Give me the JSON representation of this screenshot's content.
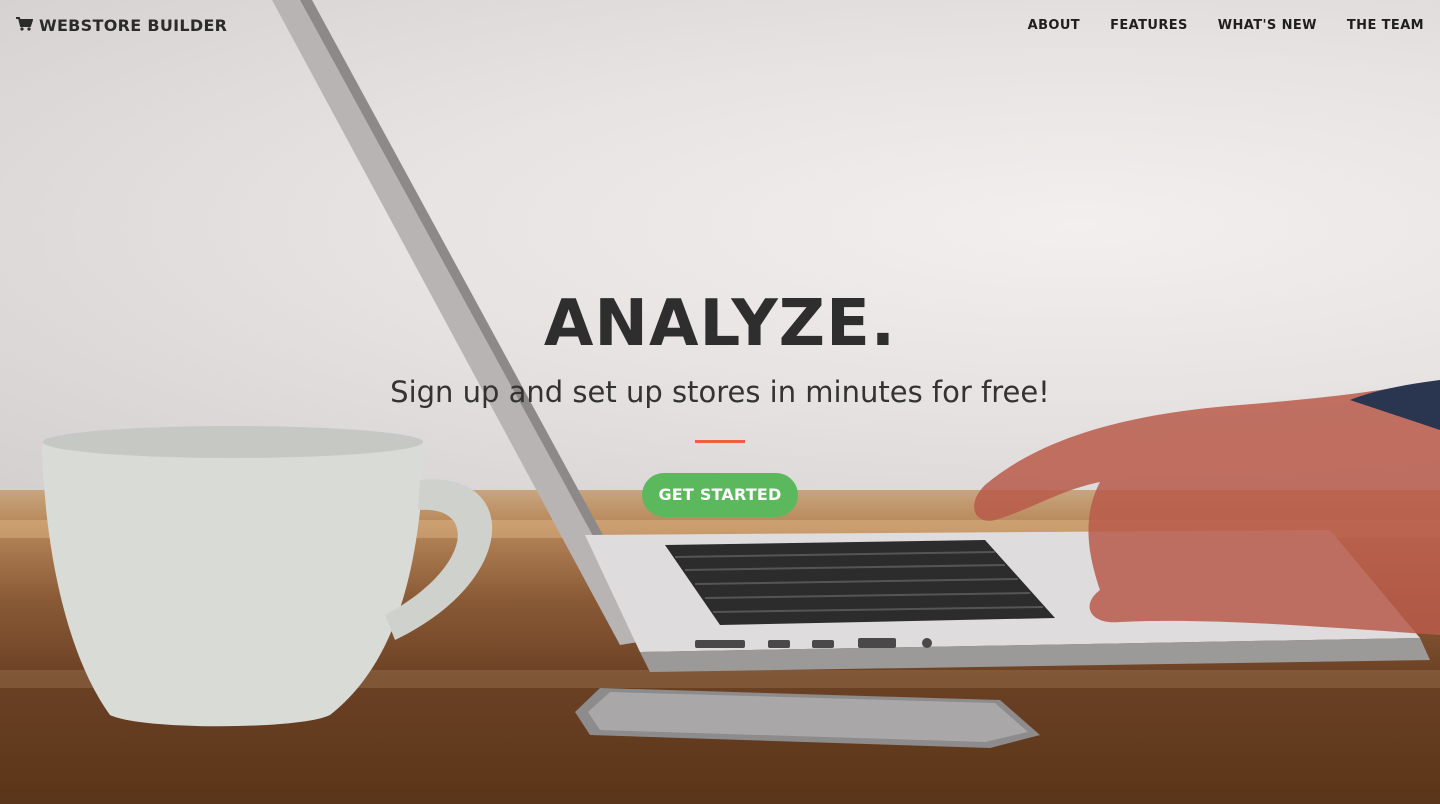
{
  "navbar": {
    "brand": "WEBSTORE BUILDER",
    "brand_icon": "shopping-cart-icon",
    "links": [
      {
        "label": "ABOUT"
      },
      {
        "label": "FEATURES"
      },
      {
        "label": "WHAT'S NEW"
      },
      {
        "label": "THE TEAM"
      }
    ]
  },
  "hero": {
    "headline": "ANALYZE.",
    "subheadline": "Sign up and set up stores in minutes for free!",
    "cta_label": "GET STARTED"
  },
  "colors": {
    "accent_divider": "#f05f40",
    "cta_background": "#5cb85c",
    "text_dark": "#2e2e2e"
  }
}
